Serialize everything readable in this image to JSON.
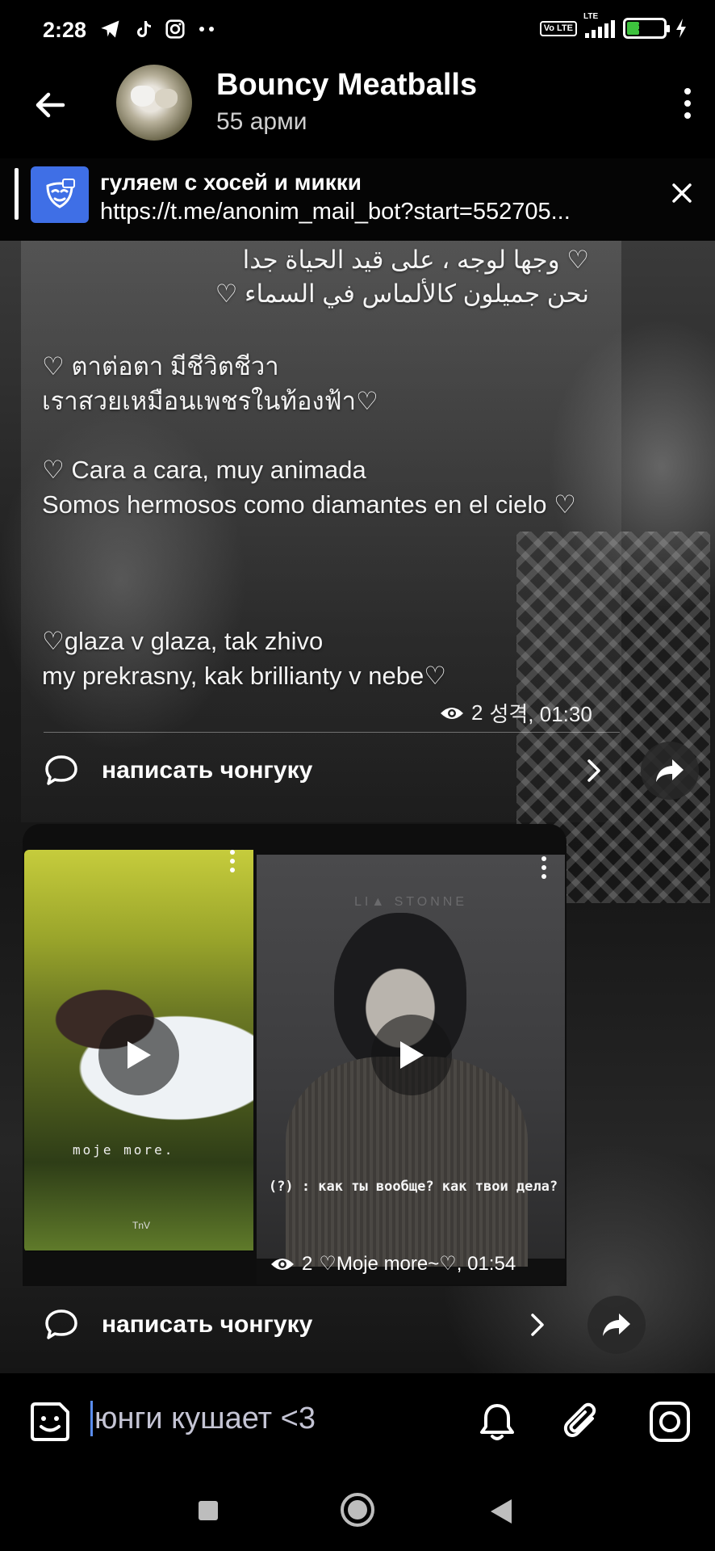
{
  "status_bar": {
    "time": "2:28",
    "left_icons": [
      "telegram-icon",
      "tiktok-icon",
      "instagram-icon",
      "more-dots-icon"
    ],
    "volte": "Vo LTE",
    "lte": "LTE",
    "battery_percent": "35",
    "battery_level": 0.35,
    "charging": true
  },
  "header": {
    "title": "Bouncy Meatballs",
    "subtitle": "55 арми"
  },
  "pinned": {
    "title": "гуляем с хосей и микки",
    "link": "https://t.me/anonim_mail_bot?start=552705..."
  },
  "message1": {
    "arabic_line1": "♡ وجها لوجه ، على قيد الحياة جدا",
    "arabic_line2": "نحن جميلون كالألماس في السماء ♡",
    "thai_line1": "♡ ตาต่อตา มีชีวิตชีวา",
    "thai_line2": " เราสวยเหมือนเพชรในท้องฟ้า♡",
    "spanish_line1": "♡ Cara a cara, muy animada",
    "spanish_line2": " Somos hermosos como diamantes en el cielo ♡",
    "translit_line1": "♡glaza v glaza, tak zhivo",
    "translit_line2": " my prekrasny, kak brillianty v nebe♡",
    "views": "2",
    "signature": "성격, 01:30",
    "comment_label": "написать чонгуку"
  },
  "message2": {
    "video1_caption": "moje more.",
    "video1_watermark": "TnV",
    "video2_brand": "LI▲ STONNE",
    "video2_caption": "(?) : как ты вообще? как твои дела?",
    "views": "2",
    "signature": "♡Moje more~♡, 01:54",
    "comment_label": "написать чонгуку"
  },
  "input": {
    "text": "юнги кушает <3"
  },
  "colors": {
    "accent": "#3f6fe6",
    "battery": "#3ec23e",
    "caret": "#5a8dee"
  }
}
